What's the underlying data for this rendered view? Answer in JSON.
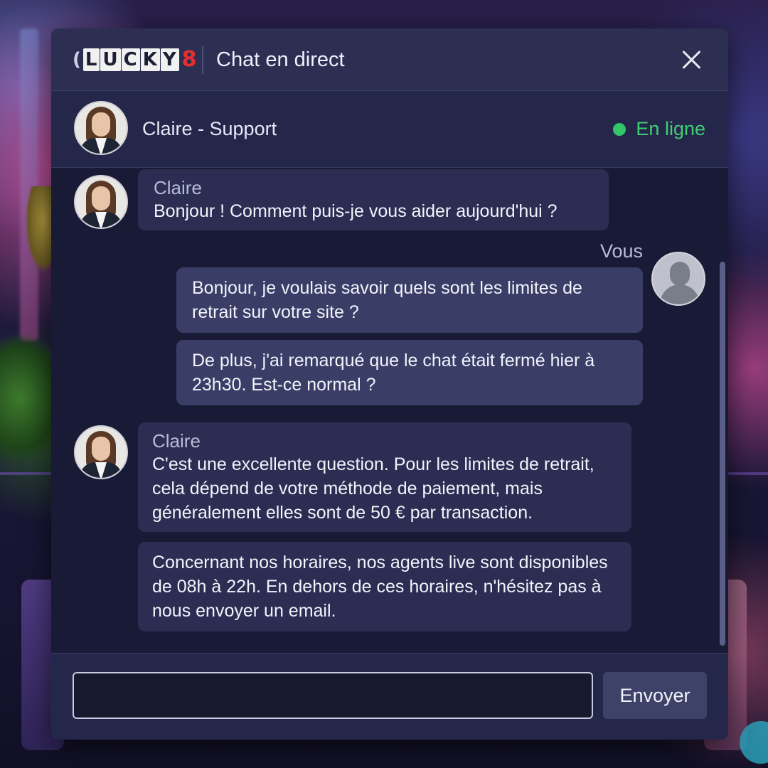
{
  "header": {
    "logo_text": "LUCKY8",
    "logo_letters": [
      "L",
      "U",
      "C",
      "K",
      "Y"
    ],
    "logo_digit": "8",
    "title": "Chat en direct",
    "close_icon": "close-icon"
  },
  "agent": {
    "name": "Claire - Support",
    "status": "En ligne",
    "status_color": "#34c46a"
  },
  "messages": [
    {
      "sender": "Claire",
      "from": "agent",
      "text": "Bonjour ! Comment puis-je vous aider aujourd'hui ?"
    },
    {
      "sender": "Vous",
      "from": "user",
      "text": "Bonjour, je voulais savoir quels sont les limites de retrait sur votre site ?"
    },
    {
      "sender": "Vous",
      "from": "user",
      "text": "De plus, j'ai remarqué que le chat était fermé hier à 23h30. Est-ce normal ?"
    },
    {
      "sender": "Claire",
      "from": "agent",
      "text": "C'est une excellente question. Pour les limites de retrait, cela dépend de votre méthode de paiement, mais généralement elles sont de 50 € par transaction."
    },
    {
      "sender": "Claire",
      "from": "agent",
      "text": "Concernant nos horaires, nos agents live sont disponibles de 08h à 22h. En dehors de ces horaires, n'hésitez pas à nous envoyer un email."
    }
  ],
  "composer": {
    "input_value": "",
    "send_label": "Envoyer"
  },
  "colors": {
    "window_bg": "#1b1d3a",
    "bubble_agent": "#2b2e52",
    "bubble_user": "#3a3e66",
    "logo_accent": "#e53030"
  }
}
